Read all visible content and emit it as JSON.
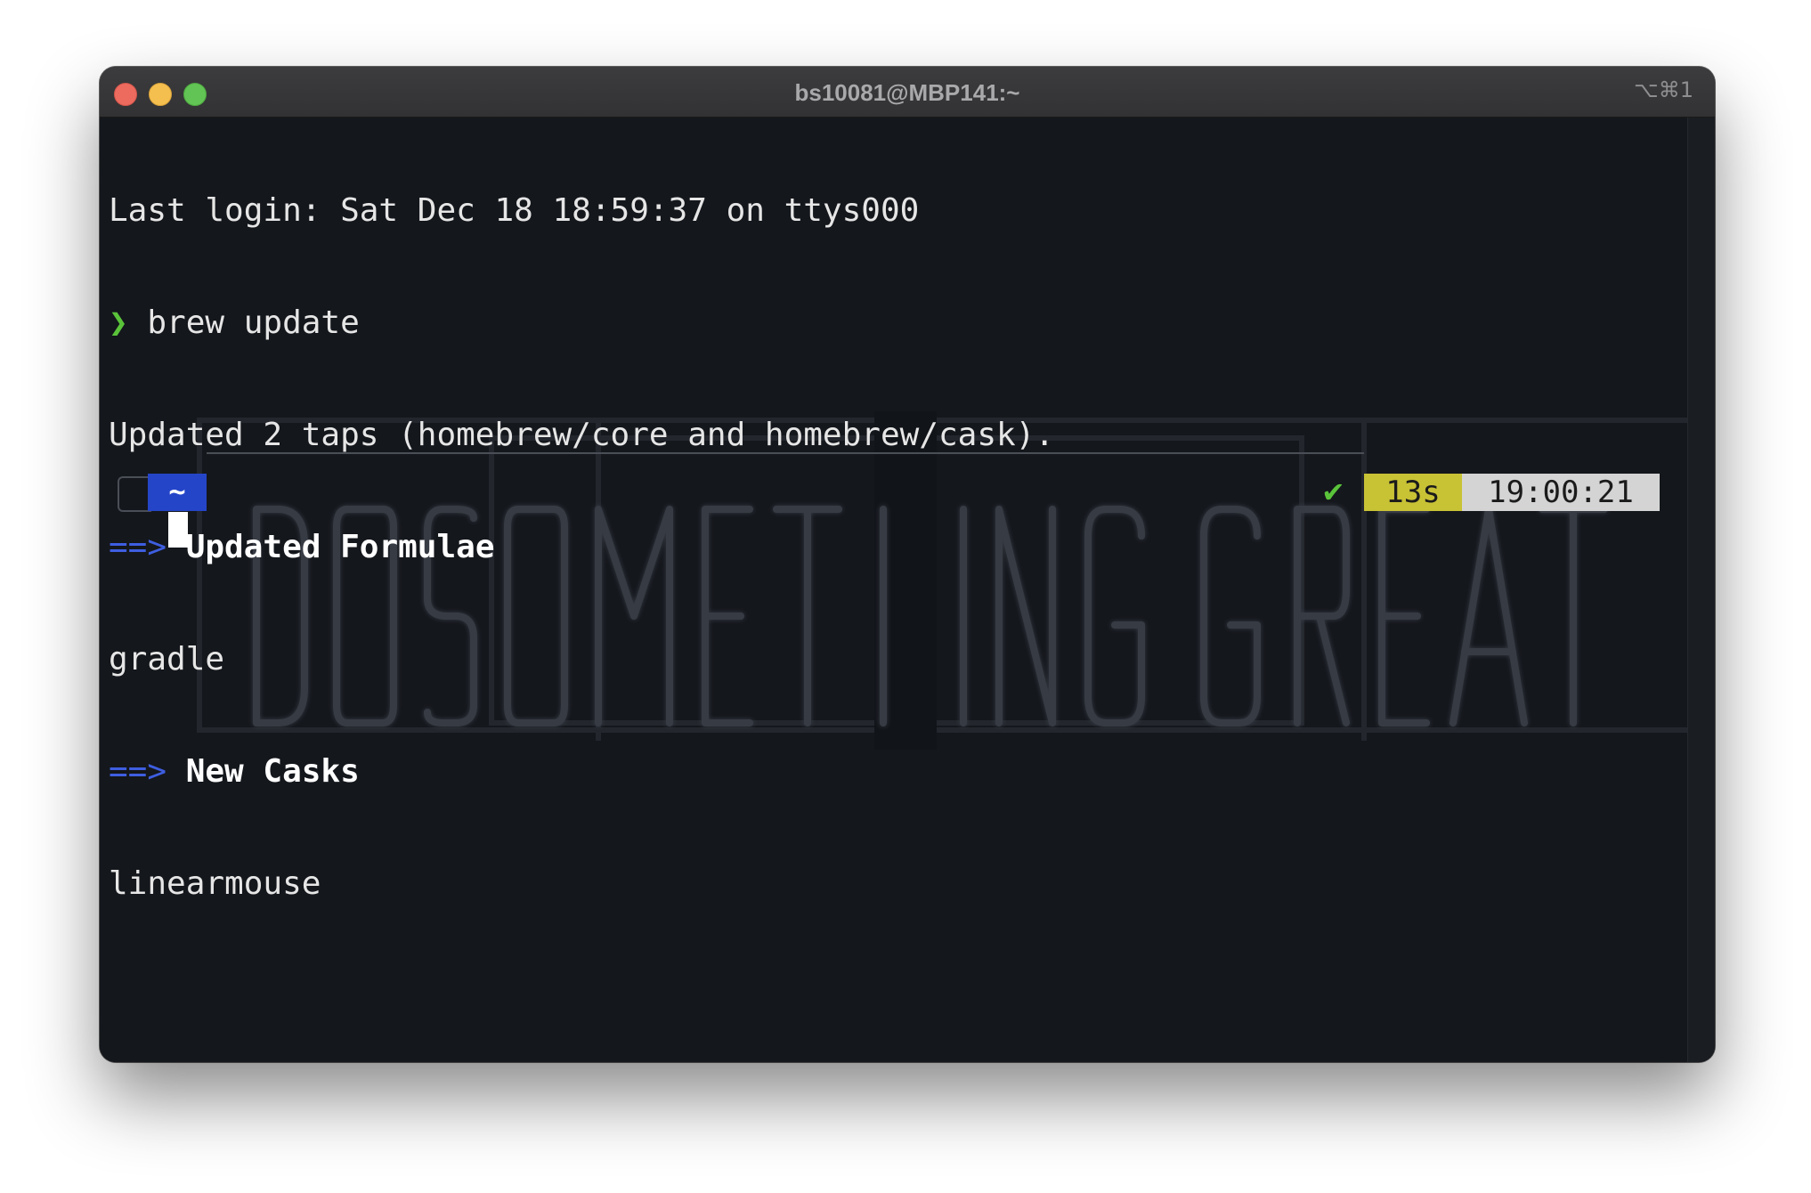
{
  "window": {
    "title": "bs10081@MBP141:~",
    "shortcut": "⌥⌘1"
  },
  "terminal": {
    "lines": [
      {
        "text": "Last login: Sat Dec 18 18:59:37 on ttys000"
      },
      {
        "prompt": "❯",
        "text": " brew update"
      },
      {
        "text": "Updated 2 taps (homebrew/core and homebrew/cask)."
      },
      {
        "arrow": "==>",
        "text": " Updated Formulae"
      },
      {
        "text": "gradle"
      },
      {
        "arrow": "==>",
        "text": " New Casks"
      },
      {
        "text": "linearmouse"
      }
    ]
  },
  "prompt": {
    "directory": "~",
    "status_icon": "check-icon",
    "status_symbol": "✔",
    "duration": "13s",
    "time": "19:00:21"
  },
  "colors": {
    "prompt_green": "#5ac33a",
    "arrow_blue": "#3e5ee0",
    "dir_blue": "#2545c8",
    "duration_yellow": "#c8c235",
    "clock_gray": "#d4d4d4",
    "background": "#14171c"
  }
}
